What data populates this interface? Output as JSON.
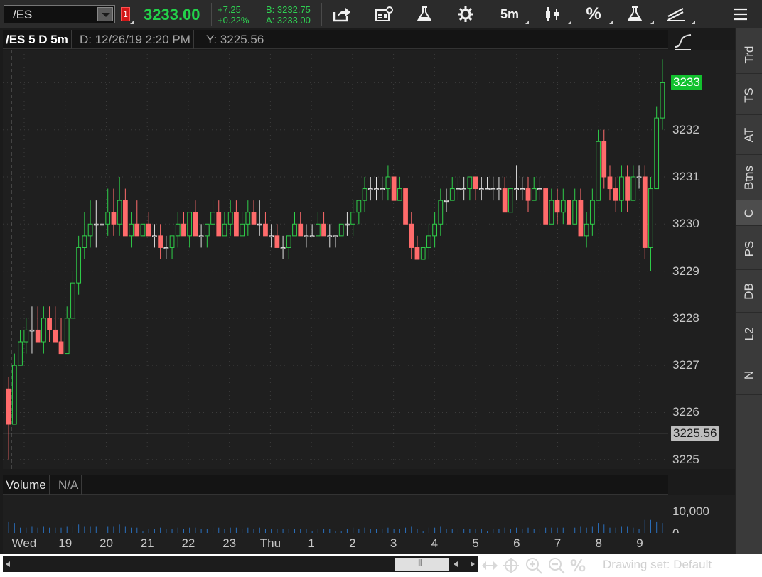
{
  "toolbar": {
    "symbol": "/ES",
    "link_badge": "1",
    "last_price": "3233.00",
    "net_change": "+7.25",
    "net_change_pct": "+0.22%",
    "bid": "B: 3232.75",
    "ask": "A: 3233.00",
    "aggregation_label": "5m",
    "percent_label": "%",
    "icons": [
      "share-icon",
      "studies-icon",
      "flask-icon",
      "gear-icon",
      "candle-style-icon",
      "percent-icon",
      "flask-drawing-icon",
      "drawing-tools-icon",
      "menu-icon"
    ]
  },
  "chart": {
    "title": "/ES 5 D 5m",
    "date": "D: 12/26/19 2:20 PM",
    "cursor_price": "Y: 3225.56",
    "last_tag": "3233",
    "cursor_tag": "3225.56",
    "y_ticks": [
      "3225",
      "3226",
      "3227",
      "3228",
      "3229",
      "3230",
      "3231",
      "3232",
      "3233"
    ],
    "x_ticks": [
      "Wed",
      "19",
      "20",
      "21",
      "22",
      "23",
      "Thu",
      "1",
      "2",
      "3",
      "4",
      "5",
      "6",
      "7",
      "8",
      "9"
    ],
    "colors": {
      "up": "#2fcf4a",
      "down": "#ff6b6b",
      "flat": "#e0e0e0",
      "background": "#1f1f1f",
      "grid": "#3c3c3c"
    }
  },
  "volume": {
    "title": "Volume",
    "value": "N/A",
    "ticks": [
      "10,000",
      "0"
    ]
  },
  "bottom_bar": {
    "drawing_set": "Drawing set: Default"
  },
  "sidebar": {
    "tabs": [
      "Trd",
      "TS",
      "AT",
      "Btns",
      "C",
      "PS",
      "DB",
      "L2",
      "N"
    ],
    "active": "C"
  },
  "chart_data": {
    "type": "candlestick",
    "title": "/ES 5 D 5m",
    "x_labels": [
      "Wed",
      "19",
      "20",
      "21",
      "22",
      "23",
      "Thu",
      "1",
      "2",
      "3",
      "4",
      "5",
      "6",
      "7",
      "8",
      "9"
    ],
    "ylim": [
      3224.8,
      3233.7
    ],
    "y_ticks": [
      3225,
      3226,
      3227,
      3228,
      3229,
      3230,
      3231,
      3232,
      3233
    ],
    "last_price": 3233,
    "crosshair_price": 3225.56,
    "grid": true,
    "ohlc": [
      [
        3226.5,
        3226.75,
        3225.0,
        3225.75
      ],
      [
        3225.75,
        3227.25,
        3225.75,
        3227.0
      ],
      [
        3227.0,
        3227.75,
        3227.0,
        3227.5
      ],
      [
        3227.5,
        3228.0,
        3227.25,
        3227.75
      ],
      [
        3227.75,
        3228.25,
        3227.25,
        3227.75
      ],
      [
        3227.75,
        3228.25,
        3227.5,
        3227.5
      ],
      [
        3227.5,
        3228.25,
        3227.25,
        3228.0
      ],
      [
        3228.0,
        3228.25,
        3227.5,
        3227.75
      ],
      [
        3227.75,
        3228.25,
        3227.5,
        3227.5
      ],
      [
        3227.5,
        3228.0,
        3227.25,
        3227.25
      ],
      [
        3227.25,
        3228.25,
        3227.25,
        3228.0
      ],
      [
        3228.0,
        3229.0,
        3228.0,
        3228.75
      ],
      [
        3228.75,
        3229.75,
        3228.5,
        3229.5
      ],
      [
        3229.5,
        3230.25,
        3229.25,
        3229.75
      ],
      [
        3229.75,
        3230.5,
        3229.5,
        3230.0
      ],
      [
        3230.0,
        3230.5,
        3229.5,
        3230.0
      ],
      [
        3230.0,
        3230.25,
        3229.75,
        3230.0
      ],
      [
        3230.0,
        3230.75,
        3229.75,
        3230.25
      ],
      [
        3230.25,
        3230.75,
        3229.75,
        3230.0
      ],
      [
        3230.0,
        3231.0,
        3229.75,
        3230.5
      ],
      [
        3230.5,
        3230.75,
        3229.75,
        3229.75
      ],
      [
        3229.75,
        3230.25,
        3229.5,
        3230.0
      ],
      [
        3230.0,
        3230.5,
        3229.75,
        3229.75
      ],
      [
        3229.75,
        3230.0,
        3229.75,
        3230.0
      ],
      [
        3230.0,
        3230.25,
        3229.75,
        3229.75
      ],
      [
        3229.75,
        3230.0,
        3229.5,
        3229.75
      ],
      [
        3229.75,
        3230.0,
        3229.25,
        3229.5
      ],
      [
        3229.5,
        3229.75,
        3229.25,
        3229.5
      ],
      [
        3229.5,
        3229.75,
        3229.25,
        3229.75
      ],
      [
        3229.75,
        3230.25,
        3229.5,
        3230.0
      ],
      [
        3230.0,
        3230.25,
        3229.75,
        3229.75
      ],
      [
        3229.75,
        3230.25,
        3229.5,
        3230.25
      ],
      [
        3230.25,
        3230.5,
        3229.75,
        3229.75
      ],
      [
        3229.75,
        3230.0,
        3229.5,
        3229.75
      ],
      [
        3229.75,
        3230.0,
        3229.5,
        3230.0
      ],
      [
        3230.0,
        3230.5,
        3229.75,
        3230.25
      ],
      [
        3230.25,
        3230.5,
        3229.75,
        3229.75
      ],
      [
        3229.75,
        3230.25,
        3229.75,
        3230.0
      ],
      [
        3230.0,
        3230.5,
        3229.75,
        3230.25
      ],
      [
        3230.25,
        3230.5,
        3229.75,
        3229.75
      ],
      [
        3229.75,
        3230.25,
        3229.75,
        3230.0
      ],
      [
        3230.0,
        3230.5,
        3229.75,
        3230.25
      ],
      [
        3230.25,
        3230.5,
        3230.0,
        3230.0
      ],
      [
        3230.0,
        3230.5,
        3229.75,
        3230.0
      ],
      [
        3230.0,
        3230.25,
        3229.75,
        3229.75
      ],
      [
        3229.75,
        3230.0,
        3229.5,
        3229.75
      ],
      [
        3229.75,
        3230.0,
        3229.5,
        3229.5
      ],
      [
        3229.5,
        3229.75,
        3229.25,
        3229.5
      ],
      [
        3229.5,
        3229.75,
        3229.25,
        3229.75
      ],
      [
        3229.75,
        3230.25,
        3229.75,
        3230.0
      ],
      [
        3230.0,
        3230.25,
        3229.75,
        3229.75
      ],
      [
        3229.75,
        3230.0,
        3229.5,
        3229.75
      ],
      [
        3229.75,
        3230.0,
        3229.75,
        3229.75
      ],
      [
        3229.75,
        3230.25,
        3229.75,
        3230.0
      ],
      [
        3230.0,
        3230.25,
        3229.75,
        3229.75
      ],
      [
        3229.75,
        3230.0,
        3229.5,
        3229.75
      ],
      [
        3229.75,
        3229.75,
        3229.5,
        3229.75
      ],
      [
        3229.75,
        3230.0,
        3229.75,
        3230.0
      ],
      [
        3230.0,
        3230.25,
        3229.75,
        3230.0
      ],
      [
        3230.0,
        3230.5,
        3229.75,
        3230.25
      ],
      [
        3230.25,
        3230.5,
        3230.0,
        3230.5
      ],
      [
        3230.5,
        3231.0,
        3230.25,
        3230.75
      ],
      [
        3230.75,
        3231.0,
        3230.5,
        3230.75
      ],
      [
        3230.75,
        3231.0,
        3230.5,
        3230.75
      ],
      [
        3230.75,
        3231.0,
        3230.5,
        3230.75
      ],
      [
        3230.75,
        3231.25,
        3230.5,
        3231.0
      ],
      [
        3231.0,
        3231.0,
        3230.5,
        3230.5
      ],
      [
        3230.5,
        3231.0,
        3230.5,
        3230.75
      ],
      [
        3230.75,
        3230.75,
        3230.0,
        3230.0
      ],
      [
        3230.0,
        3230.25,
        3229.25,
        3229.5
      ],
      [
        3229.5,
        3229.75,
        3229.25,
        3229.25
      ],
      [
        3229.25,
        3229.5,
        3229.25,
        3229.5
      ],
      [
        3229.5,
        3230.0,
        3229.25,
        3229.75
      ],
      [
        3229.75,
        3230.25,
        3229.5,
        3230.0
      ],
      [
        3230.0,
        3230.75,
        3229.75,
        3230.5
      ],
      [
        3230.5,
        3230.75,
        3230.25,
        3230.5
      ],
      [
        3230.5,
        3231.0,
        3230.5,
        3230.75
      ],
      [
        3230.75,
        3231.0,
        3230.5,
        3230.75
      ],
      [
        3230.75,
        3231.0,
        3230.5,
        3230.75
      ],
      [
        3230.75,
        3231.0,
        3230.5,
        3231.0
      ],
      [
        3231.0,
        3231.0,
        3230.5,
        3230.75
      ],
      [
        3230.75,
        3231.0,
        3230.5,
        3230.75
      ],
      [
        3230.75,
        3231.0,
        3230.75,
        3230.75
      ],
      [
        3230.75,
        3231.0,
        3230.5,
        3230.75
      ],
      [
        3230.75,
        3231.0,
        3230.5,
        3230.75
      ],
      [
        3230.75,
        3231.0,
        3230.25,
        3230.25
      ],
      [
        3230.25,
        3230.75,
        3230.25,
        3230.75
      ],
      [
        3230.75,
        3231.25,
        3230.5,
        3230.75
      ],
      [
        3230.75,
        3231.0,
        3230.5,
        3230.75
      ],
      [
        3230.75,
        3231.0,
        3230.25,
        3230.5
      ],
      [
        3230.5,
        3231.0,
        3230.5,
        3230.75
      ],
      [
        3230.75,
        3231.0,
        3230.5,
        3230.75
      ],
      [
        3230.75,
        3230.75,
        3230.0,
        3230.0
      ],
      [
        3230.0,
        3230.75,
        3230.0,
        3230.5
      ],
      [
        3230.5,
        3230.75,
        3230.0,
        3230.25
      ],
      [
        3230.25,
        3230.75,
        3230.0,
        3230.5
      ],
      [
        3230.5,
        3230.75,
        3230.0,
        3230.0
      ],
      [
        3230.0,
        3230.75,
        3230.0,
        3230.5
      ],
      [
        3230.5,
        3230.75,
        3229.75,
        3229.75
      ],
      [
        3229.75,
        3230.25,
        3229.5,
        3230.0
      ],
      [
        3230.0,
        3230.75,
        3229.75,
        3230.5
      ],
      [
        3230.5,
        3232.0,
        3230.5,
        3231.75
      ],
      [
        3231.75,
        3232.0,
        3230.75,
        3231.0
      ],
      [
        3231.0,
        3231.25,
        3230.5,
        3230.75
      ],
      [
        3230.75,
        3231.0,
        3230.25,
        3230.5
      ],
      [
        3230.5,
        3231.25,
        3230.25,
        3231.0
      ],
      [
        3231.0,
        3231.25,
        3230.25,
        3230.5
      ],
      [
        3230.5,
        3231.25,
        3230.5,
        3231.0
      ],
      [
        3231.0,
        3231.25,
        3230.75,
        3231.0
      ],
      [
        3231.0,
        3231.25,
        3229.25,
        3229.5
      ],
      [
        3229.5,
        3231.0,
        3229.0,
        3230.75
      ],
      [
        3230.75,
        3232.5,
        3230.75,
        3232.25
      ],
      [
        3232.25,
        3233.5,
        3232.0,
        3233.0
      ]
    ],
    "volume_ticks": [
      0,
      10000
    ]
  }
}
